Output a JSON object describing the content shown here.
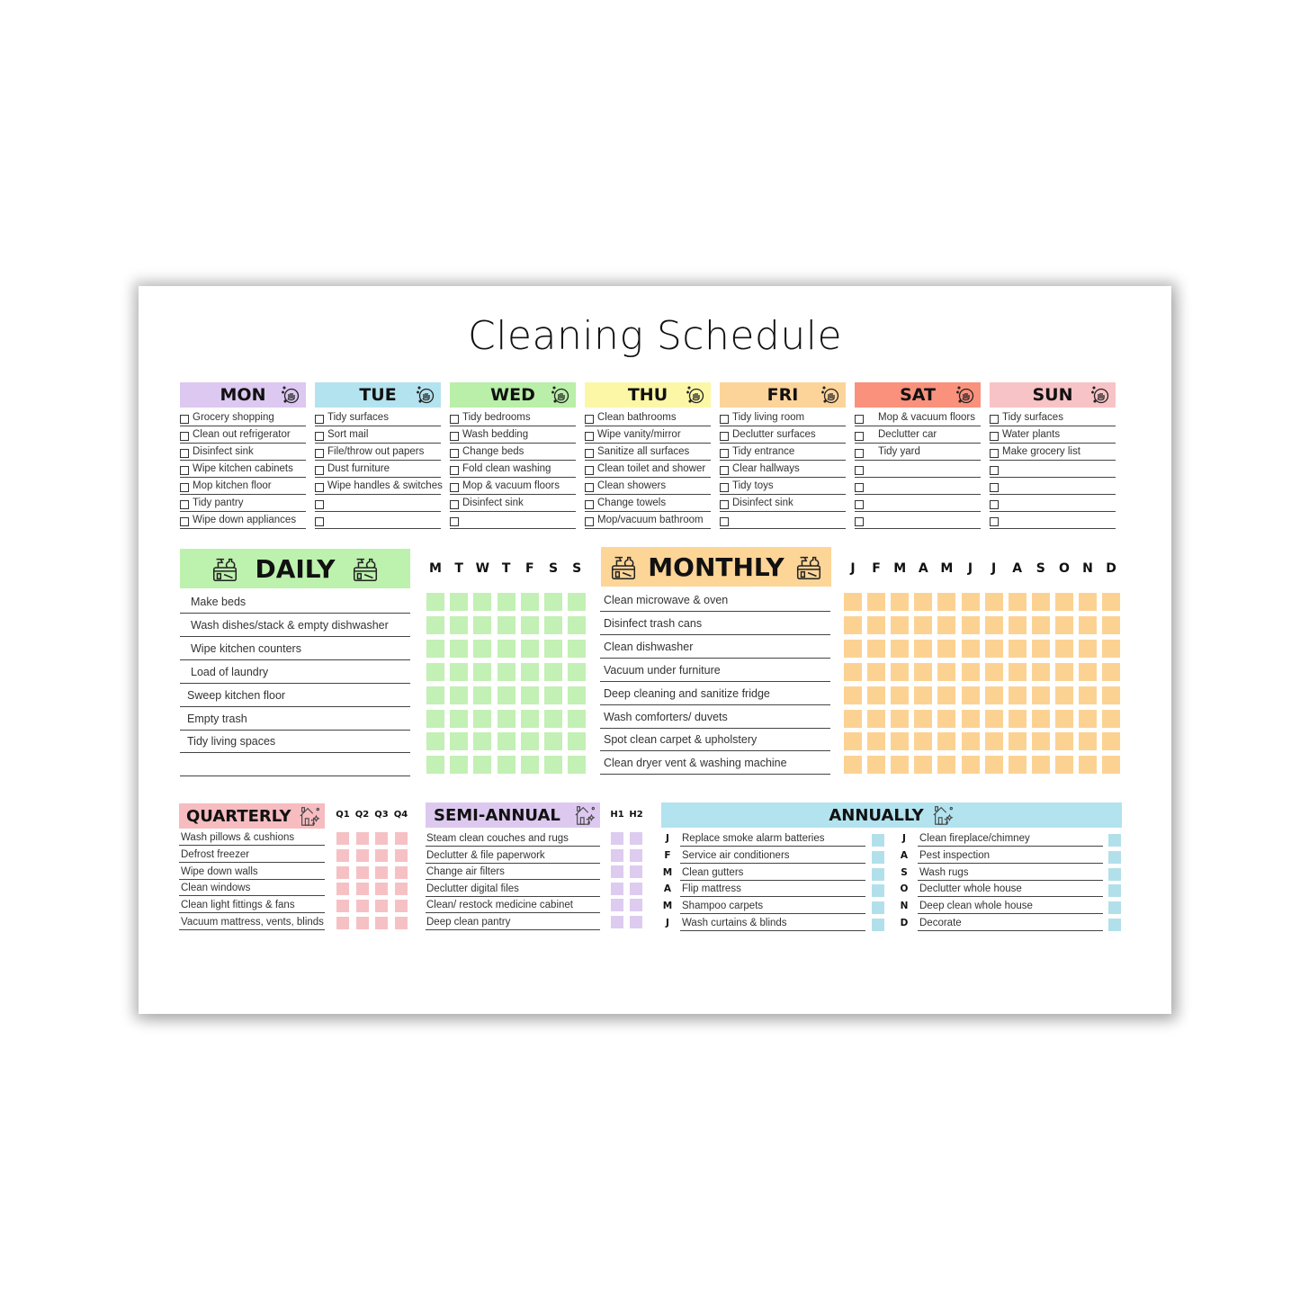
{
  "title": "Cleaning Schedule",
  "colors": {
    "mon": "#dcc8f0",
    "tue": "#b3e3ef",
    "wed": "#b9efa8",
    "thu": "#fbf7a7",
    "fri": "#fcd49a",
    "sat": "#f9917d",
    "sun": "#f8c3c6",
    "daily": "#bdf2ae",
    "daily_box": "#c3f0b4",
    "monthly": "#fdd597",
    "monthly_box": "#fcd293",
    "quarterly": "#f6bcc0",
    "quarterly_box": "#f6c1c4",
    "semi_annual": "#ddc9f0",
    "semi_box": "#ddcbf0",
    "annually": "#b2e3ef",
    "annual_box": "#b2e0ea"
  },
  "week": [
    {
      "day": "MON",
      "color_key": "mon",
      "icon": "hand-washing-icon",
      "tasks": [
        "Grocery shopping",
        "Clean out refrigerator",
        "Disinfect sink",
        "Wipe kitchen cabinets",
        "Mop kitchen floor",
        "Tidy pantry",
        "Wipe down appliances"
      ]
    },
    {
      "day": "TUE",
      "color_key": "tue",
      "icon": "hand-washing-icon",
      "tasks": [
        "Tidy surfaces",
        "Sort mail",
        "File/throw out papers",
        "Dust furniture",
        "Wipe handles & switches",
        "",
        ""
      ]
    },
    {
      "day": "WED",
      "color_key": "wed",
      "icon": "hand-washing-icon",
      "tasks": [
        "Tidy bedrooms",
        "Wash bedding",
        "Change beds",
        "Fold clean washing",
        "Mop & vacuum floors",
        "Disinfect sink",
        ""
      ]
    },
    {
      "day": "THU",
      "color_key": "thu",
      "icon": "hand-washing-icon",
      "tasks": [
        "Clean bathrooms",
        "Wipe vanity/mirror",
        "Sanitize all surfaces",
        "Clean toilet and shower",
        "Clean showers",
        "Change towels",
        "Mop/vacuum bathroom"
      ]
    },
    {
      "day": "FRI",
      "color_key": "fri",
      "icon": "hand-washing-icon",
      "tasks": [
        "Tidy living room",
        "Declutter surfaces",
        "Tidy entrance",
        "Clear hallways",
        "Tidy toys",
        "Disinfect sink",
        ""
      ]
    },
    {
      "day": "SAT",
      "color_key": "sat",
      "icon": "hand-washing-icon",
      "tasks": [
        "Mop & vacuum floors",
        "Declutter car",
        "Tidy yard",
        "",
        "",
        "",
        ""
      ]
    },
    {
      "day": "SUN",
      "color_key": "sun",
      "icon": "hand-washing-icon",
      "tasks": [
        "Tidy surfaces",
        "Water plants",
        "Make grocery list",
        "",
        "",
        "",
        ""
      ]
    }
  ],
  "daily": {
    "title": "DAILY",
    "icon": "cleaning-supplies-icon",
    "columns": [
      "M",
      "T",
      "W",
      "T",
      "F",
      "S",
      "S"
    ],
    "tasks": [
      "Make beds",
      "Wash dishes/stack & empty dishwasher",
      "Wipe kitchen counters",
      "Load of laundry",
      "Sweep kitchen floor",
      "Empty trash",
      "Tidy living spaces",
      ""
    ]
  },
  "monthly": {
    "title": "MONTHLY",
    "icon": "cleaning-supplies-icon",
    "columns": [
      "J",
      "F",
      "M",
      "A",
      "M",
      "J",
      "J",
      "A",
      "S",
      "O",
      "N",
      "D"
    ],
    "tasks": [
      "Clean microwave & oven",
      "Disinfect trash cans",
      "Clean dishwasher",
      "Vacuum under furniture",
      "Deep cleaning and sanitize fridge",
      "Wash comforters/ duvets",
      "Spot clean carpet & upholstery",
      "Clean dryer vent & washing machine"
    ]
  },
  "quarterly": {
    "title": "QUARTERLY",
    "icon": "sparkling-house-icon",
    "columns": [
      "Q1",
      "Q2",
      "Q3",
      "Q4"
    ],
    "tasks": [
      "Wash pillows & cushions",
      "Defrost freezer",
      "Wipe down walls",
      "Clean windows",
      "Clean light fittings & fans",
      "Vacuum mattress, vents, blinds"
    ]
  },
  "semi_annual": {
    "title": "SEMI-ANNUAL",
    "icon": "sparkling-house-icon",
    "columns": [
      "H1",
      "H2"
    ],
    "tasks": [
      "Steam clean couches and rugs",
      "Declutter & file paperwork",
      "Change air filters",
      "Declutter digital files",
      "Clean/ restock medicine cabinet",
      "Deep clean pantry"
    ]
  },
  "annually": {
    "title": "ANNUALLY",
    "icon": "sparkling-house-icon",
    "left": [
      {
        "month": "J",
        "task": "Replace smoke alarm batteries"
      },
      {
        "month": "F",
        "task": "Service air conditioners"
      },
      {
        "month": "M",
        "task": "Clean gutters"
      },
      {
        "month": "A",
        "task": "Flip mattress"
      },
      {
        "month": "M",
        "task": "Shampoo carpets"
      },
      {
        "month": "J",
        "task": "Wash curtains & blinds"
      }
    ],
    "right": [
      {
        "month": "J",
        "task": "Clean fireplace/chimney"
      },
      {
        "month": "A",
        "task": "Pest inspection"
      },
      {
        "month": "S",
        "task": "Wash rugs"
      },
      {
        "month": "O",
        "task": "Declutter whole house"
      },
      {
        "month": "N",
        "task": "Deep clean whole house"
      },
      {
        "month": "D",
        "task": "Decorate"
      }
    ]
  }
}
